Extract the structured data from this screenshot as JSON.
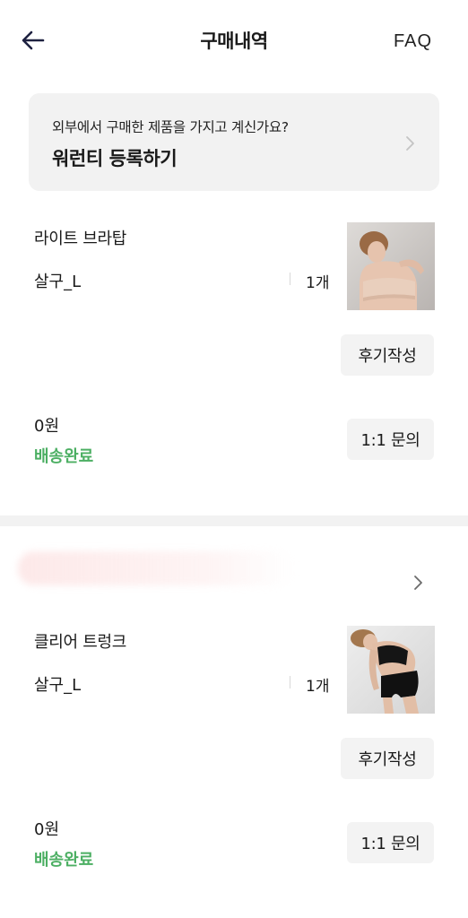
{
  "header": {
    "title": "구매내역",
    "faq_label": "FAQ"
  },
  "warranty": {
    "subtitle": "외부에서 구매한 제품을 가지고 계신가요?",
    "title": "워런티 등록하기"
  },
  "orders": [
    {
      "product_name": "라이트 브라탑",
      "option": "살구_L",
      "quantity": "1개",
      "review_label": "후기작성",
      "price": "0원",
      "status": "배송완료",
      "inquiry_label": "1:1 문의"
    },
    {
      "product_name": "클리어 트렁크",
      "option": "살구_L",
      "quantity": "1개",
      "review_label": "후기작성",
      "price": "0원",
      "status": "배송완료",
      "inquiry_label": "1:1 문의"
    }
  ],
  "colors": {
    "status_green": "#4caf63",
    "banner_bg": "#f2f2f2",
    "button_bg": "#f3f3f3"
  },
  "icons": {
    "back": "arrow-left-icon",
    "chevron": "chevron-right-icon"
  }
}
